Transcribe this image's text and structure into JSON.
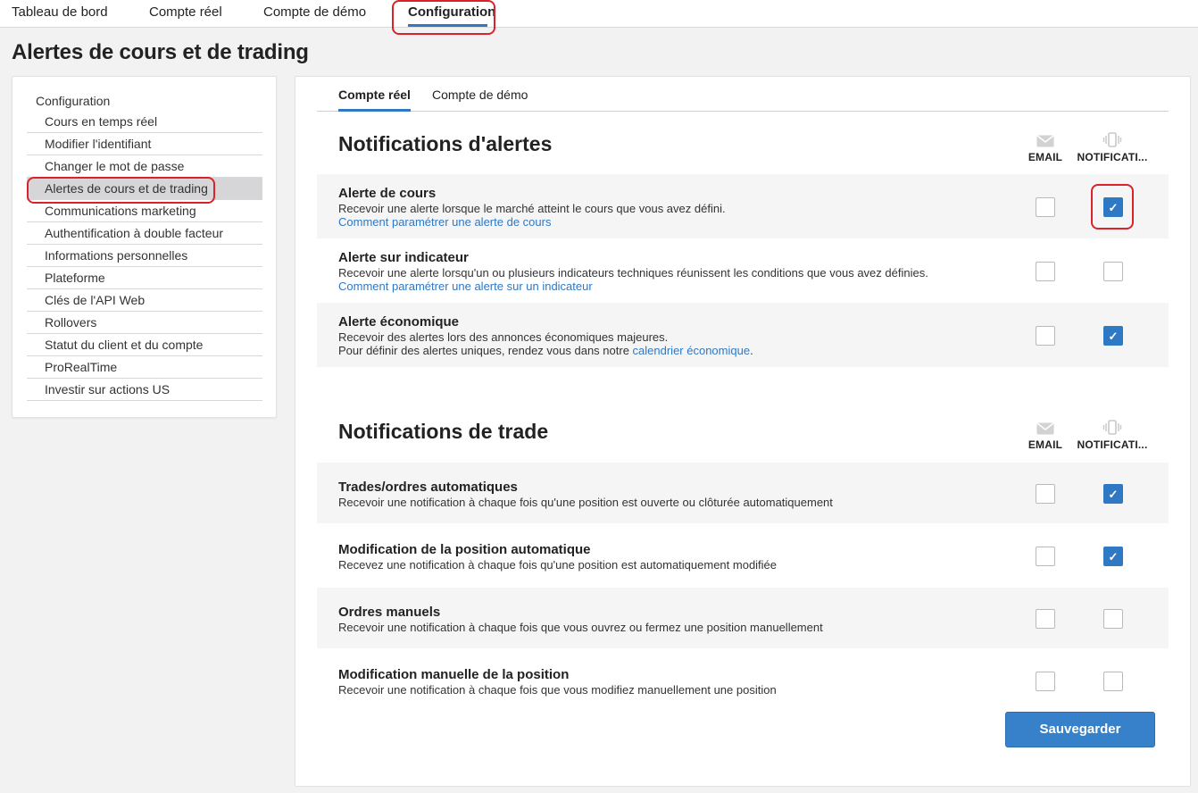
{
  "top_tabs": [
    {
      "label": "Tableau de bord"
    },
    {
      "label": "Compte réel"
    },
    {
      "label": "Compte de démo"
    },
    {
      "label": "Configuration",
      "active": true
    }
  ],
  "page_title": "Alertes de cours et de trading",
  "sidebar": {
    "heading": "Configuration",
    "items": [
      {
        "label": "Cours en temps réel"
      },
      {
        "label": "Modifier l'identifiant"
      },
      {
        "label": "Changer le mot de passe"
      },
      {
        "label": "Alertes de cours et de trading",
        "active": true
      },
      {
        "label": "Communications marketing"
      },
      {
        "label": "Authentification à double facteur"
      },
      {
        "label": "Informations personnelles"
      },
      {
        "label": "Plateforme"
      },
      {
        "label": "Clés de l'API Web"
      },
      {
        "label": "Rollovers"
      },
      {
        "label": "Statut du client et du compte"
      },
      {
        "label": "ProRealTime"
      },
      {
        "label": "Investir sur actions US"
      }
    ]
  },
  "sub_tabs": [
    {
      "label": "Compte réel",
      "active": true
    },
    {
      "label": "Compte de démo"
    }
  ],
  "columns": {
    "email": "EMAIL",
    "notifications": "NOTIFICATI..."
  },
  "alert_section": {
    "title": "Notifications d'alertes",
    "rows": [
      {
        "title": "Alerte de cours",
        "desc": "Recevoir une alerte lorsque le marché atteint le cours que vous avez défini.",
        "link": "Comment paramétrer une alerte de cours",
        "email": false,
        "notif": true
      },
      {
        "title": "Alerte sur indicateur",
        "desc": "Recevoir une alerte lorsqu'un ou plusieurs indicateurs techniques réunissent les conditions que vous avez définies.",
        "link": "Comment paramétrer une alerte sur un indicateur",
        "email": false,
        "notif": false
      },
      {
        "title": "Alerte économique",
        "desc": "Recevoir des alertes lors des annonces économiques majeures.",
        "desc2_prefix": "Pour définir des alertes uniques, rendez vous dans notre ",
        "desc2_link": "calendrier économique",
        "desc2_suffix": ".",
        "email": false,
        "notif": true
      }
    ]
  },
  "trade_section": {
    "title": "Notifications de trade",
    "rows": [
      {
        "title": "Trades/ordres automatiques",
        "desc": "Recevoir une notification à chaque fois qu'une position est ouverte ou clôturée automatiquement",
        "email": false,
        "notif": true
      },
      {
        "title": "Modification de la position automatique",
        "desc": "Recevez une notification à chaque fois qu'une position est automatiquement modifiée",
        "email": false,
        "notif": true
      },
      {
        "title": "Ordres manuels",
        "desc": "Recevoir une notification à chaque fois que vous ouvrez ou fermez une position manuellement",
        "email": false,
        "notif": false
      },
      {
        "title": "Modification manuelle de la position",
        "desc": "Recevoir une notification à chaque fois que vous modifiez manuellement une position",
        "email": false,
        "notif": false
      }
    ]
  },
  "save_label": "Sauvegarder",
  "check_glyph": "✓",
  "icons": {
    "email": "envelope-icon",
    "notifications": "vibrating-phone-icon"
  },
  "colors": {
    "accent": "#2f78c4",
    "highlight": "#d9232a",
    "sidebar_active": "#d6d6d8"
  }
}
